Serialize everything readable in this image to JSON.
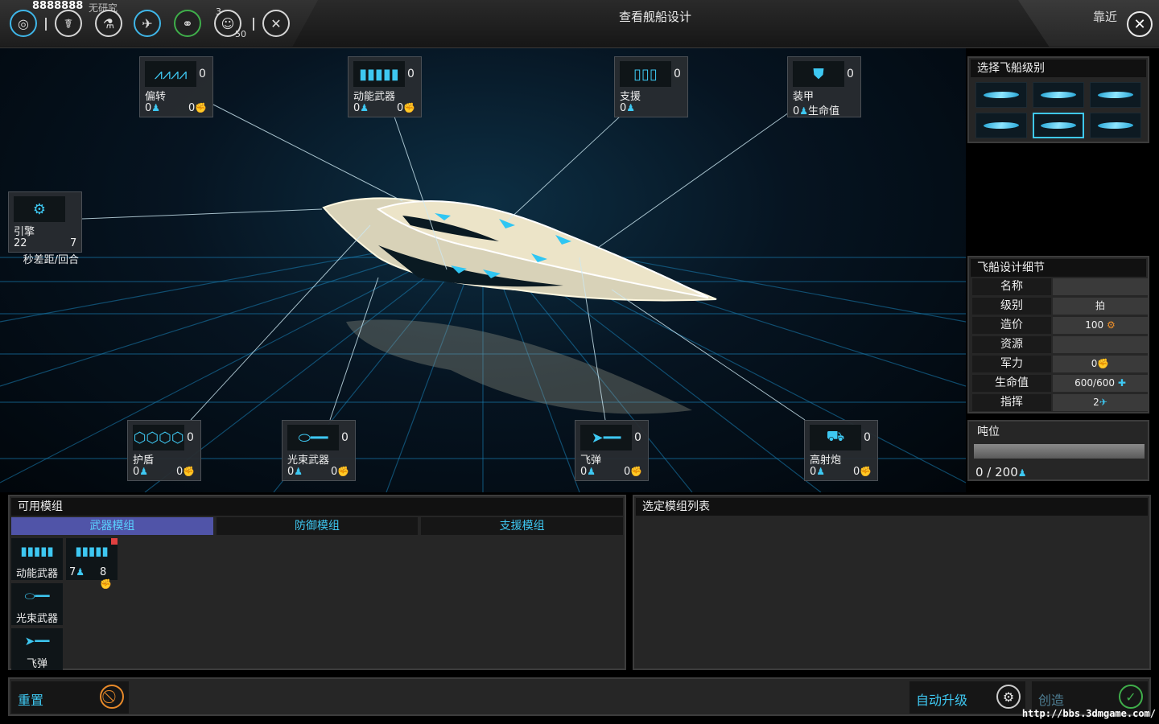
{
  "topbar": {
    "resource_count": "8888888",
    "status": "无研究",
    "badge_top": "3",
    "badge_bottom": "50",
    "title": "查看舰船设计",
    "zoom_label": "靠近",
    "icons": [
      "galaxy-icon",
      "laurel-icon",
      "research-icon",
      "ship-icon",
      "diplomacy-icon",
      "population-icon",
      "tools-icon"
    ]
  },
  "slots": {
    "deflect": {
      "name": "偏转",
      "count": "0",
      "v1": "0",
      "v2": "0"
    },
    "kinetic": {
      "name": "动能武器",
      "count": "0",
      "v1": "0",
      "v2": "0"
    },
    "support": {
      "name": "支援",
      "count": "0",
      "v1": "0"
    },
    "armor": {
      "name": "装甲",
      "count": "0",
      "v1": "0",
      "v1_extra": "生命值"
    },
    "engine": {
      "name": "引擎",
      "v1": "22",
      "v2": "7",
      "desc": "秒差距/回合"
    },
    "shield": {
      "name": "护盾",
      "count": "0",
      "v1": "0",
      "v2": "0"
    },
    "beam": {
      "name": "光束武器",
      "count": "0",
      "v1": "0",
      "v2": "0"
    },
    "missile": {
      "name": "飞弹",
      "count": "0",
      "v1": "0",
      "v2": "0"
    },
    "artillery": {
      "name": "高射炮",
      "count": "0",
      "v1": "0",
      "v2": "0"
    }
  },
  "class_panel": {
    "title": "选择飞船级别",
    "selected_index": 4,
    "count": 6
  },
  "detail_panel": {
    "title": "飞船设计细节",
    "rows": [
      {
        "k": "名称",
        "v": ""
      },
      {
        "k": "级别",
        "v": "拍"
      },
      {
        "k": "造价",
        "v": "100"
      },
      {
        "k": "资源",
        "v": ""
      },
      {
        "k": "军力",
        "v": "0"
      },
      {
        "k": "生命值",
        "v": "600/600"
      },
      {
        "k": "指挥",
        "v": "2"
      }
    ]
  },
  "tonnage": {
    "title": "吨位",
    "value": "0 / 200",
    "fill": 0.0
  },
  "available": {
    "title": "可用模组",
    "tabs": [
      "武器模组",
      "防御模组",
      "支援模组"
    ],
    "active_tab": 0,
    "modules": [
      {
        "label": "动能武器"
      },
      {
        "v1": "7",
        "v2": "8",
        "flag": true
      },
      {
        "label": "光束武器"
      },
      {
        "label": "飞弹"
      }
    ]
  },
  "selected": {
    "title": "选定模组列表"
  },
  "actions": {
    "reset": "重置",
    "auto_upgrade": "自动升级",
    "create": "创造"
  },
  "watermark": "http://bbs.3dmgame.com/",
  "colors": {
    "accent": "#3ec8f2",
    "tab_active": "#5054a8",
    "panel": "#262626"
  }
}
